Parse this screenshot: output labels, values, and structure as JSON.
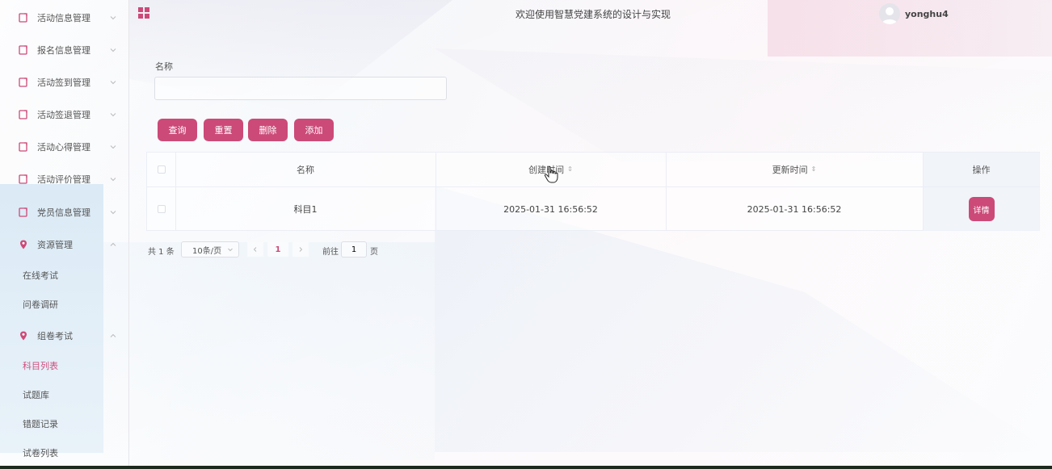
{
  "colors": {
    "accent": "#cc4a78",
    "sidebar_icon": "#cc4a78"
  },
  "header": {
    "title": "欢迎使用智慧党建系统的设计与实现",
    "username": "yonghu4"
  },
  "sidebar": {
    "menus": [
      {
        "label": "活动信息管理",
        "icon": "doc-icon",
        "expanded": false
      },
      {
        "label": "报名信息管理",
        "icon": "doc-icon",
        "expanded": false
      },
      {
        "label": "活动签到管理",
        "icon": "doc-icon",
        "expanded": false
      },
      {
        "label": "活动签退管理",
        "icon": "doc-icon",
        "expanded": false
      },
      {
        "label": "活动心得管理",
        "icon": "doc-icon",
        "expanded": false
      },
      {
        "label": "活动评价管理",
        "icon": "doc-icon",
        "expanded": false
      },
      {
        "label": "党员信息管理",
        "icon": "doc-icon",
        "expanded": false
      },
      {
        "label": "资源管理",
        "icon": "map-pin-icon",
        "expanded": true
      },
      {
        "label": "组卷考试",
        "icon": "map-pin-icon",
        "expanded": true
      }
    ],
    "resource_sub": [
      "在线考试",
      "问卷调研"
    ],
    "exam_sub": [
      "科目列表",
      "试题库",
      "错题记录",
      "试卷列表"
    ],
    "active_sub": "科目列表"
  },
  "search": {
    "label": "名称",
    "value": "",
    "placeholder": ""
  },
  "buttons": {
    "query": "查询",
    "reset": "重置",
    "delete": "删除",
    "add": "添加"
  },
  "table": {
    "headers": {
      "name": "名称",
      "created": "创建时间",
      "updated": "更新时间",
      "ops": "操作"
    },
    "rows": [
      {
        "name": "科目1",
        "created": "2025-01-31 16:56:52",
        "updated": "2025-01-31 16:56:52",
        "detail": "详情"
      }
    ]
  },
  "pagination": {
    "total": "共 1 条",
    "page_size": "10条/页",
    "current": "1",
    "goto_prefix": "前往",
    "goto_value": "1",
    "goto_suffix": "页"
  }
}
